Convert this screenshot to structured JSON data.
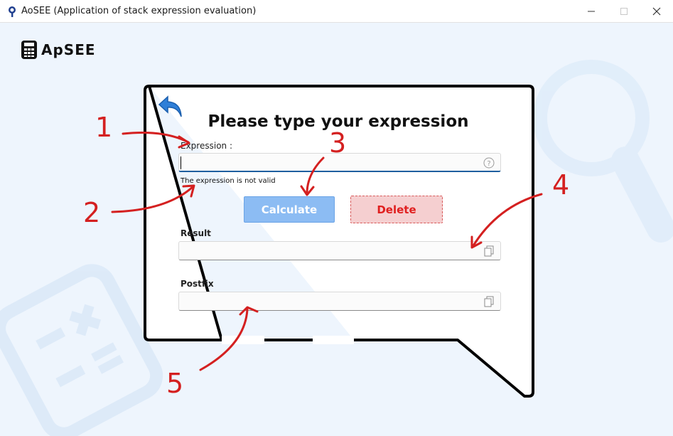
{
  "window": {
    "title": "AoSEE (Application of stack expression evaluation)",
    "minimize_icon": "minimize-icon",
    "maximize_icon": "maximize-icon",
    "close_icon": "close-icon"
  },
  "logo": {
    "text": "ApSEE",
    "icon": "calculator-icon"
  },
  "card": {
    "title": "Please type your expression",
    "back_icon": "back-arrow-icon"
  },
  "expression": {
    "label": "Expression :",
    "value": "",
    "help_icon": "help-icon",
    "error": "The expression is not valid"
  },
  "buttons": {
    "calculate": "Calculate",
    "delete": "Delete"
  },
  "result": {
    "label": "Result",
    "value": "",
    "copy_icon": "copy-icon"
  },
  "postfix": {
    "label": "Postfix",
    "value": "",
    "copy_icon": "copy-icon"
  },
  "annotations": [
    "1",
    "2",
    "3",
    "4",
    "5"
  ],
  "colors": {
    "accent": "#2f7fd8",
    "calculate_bg": "#8cbcf3",
    "delete_bg": "#f5cfd0",
    "delete_text": "#e02020",
    "annotation": "#d42020",
    "background": "#eef5fd"
  }
}
